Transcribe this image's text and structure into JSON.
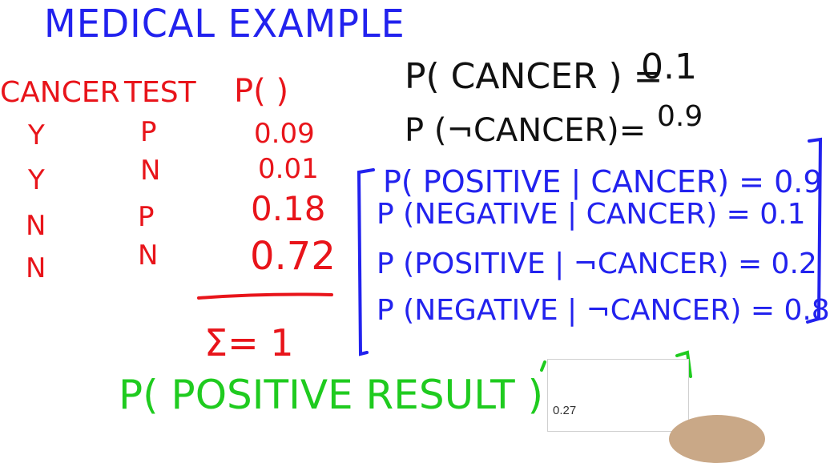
{
  "title": "MEDICAL EXAMPLE",
  "table": {
    "headers": [
      "CANCER",
      "TEST",
      "P(   )"
    ],
    "rows": [
      {
        "cancer": "Y",
        "test": "P",
        "p": "0.09"
      },
      {
        "cancer": "Y",
        "test": "N",
        "p": "0.01"
      },
      {
        "cancer": "N",
        "test": "P",
        "p": "0.18"
      },
      {
        "cancer": "N",
        "test": "N",
        "p": "0.72"
      }
    ],
    "sum": "Σ= 1"
  },
  "priors": [
    {
      "label": "P( CANCER ) =",
      "value": "0.1"
    },
    {
      "label": "P (¬CANCER)=",
      "value": "0.9"
    }
  ],
  "conditionals": [
    "P( POSITIVE | CANCER) = 0.9",
    "P (NEGATIVE | CANCER) = 0.1",
    "P (POSITIVE | ¬CANCER) = 0.2",
    "P (NEGATIVE | ¬CANCER) = 0.8"
  ],
  "question": "P( POSITIVE RESULT ) =",
  "answer_input": {
    "value": "0.27"
  },
  "colors": {
    "blue": "#2222ee",
    "red": "#e8141a",
    "black": "#111111",
    "green": "#1fcb1f"
  }
}
